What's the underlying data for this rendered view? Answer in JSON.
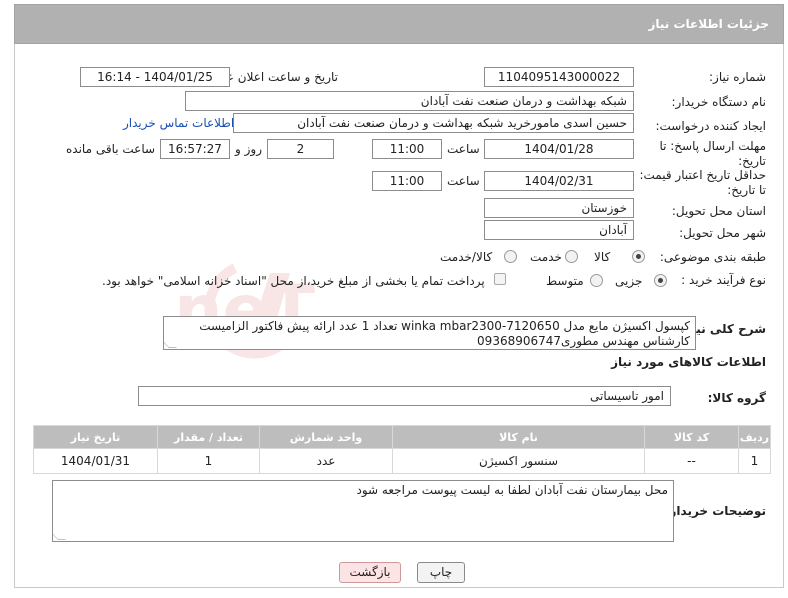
{
  "header": {
    "title": "جزئیات اطلاعات نیاز"
  },
  "fields": {
    "need_number_label": "شماره نیاز:",
    "need_number": "1104095143000022",
    "announce_label": "تاریخ و ساعت اعلان عمومی:",
    "announce_value": "1404/01/25 - 16:14",
    "buyer_org_label": "نام دستگاه خریدار:",
    "buyer_org": "شبکه بهداشت و درمان صنعت نفت آبادان",
    "requester_label": "ایجاد کننده درخواست:",
    "requester": "حسین اسدی مامورخرید شبکه بهداشت و درمان صنعت نفت آبادان",
    "contact_link": "اطلاعات تماس خریدار",
    "reply_deadline_label": "مهلت ارسال پاسخ: تا تاریخ:",
    "reply_date": "1404/01/28",
    "time_label": "ساعت",
    "reply_time": "11:00",
    "days_value": "2",
    "days_label": "روز و",
    "remaining_time": "16:57:27",
    "remaining_label": "ساعت باقی مانده",
    "price_validity_label": "حداقل تاریخ اعتبار قیمت: تا تاریخ:",
    "price_date": "1404/02/31",
    "price_time": "11:00",
    "province_label": "استان محل تحویل:",
    "province": "خوزستان",
    "city_label": "شهر محل تحویل:",
    "city": "آبادان",
    "category_label": "طبقه بندی موضوعی:",
    "category_options": [
      "کالا",
      "خدمت",
      "کالا/خدمت"
    ],
    "process_label": "نوع فرآیند خرید :",
    "process_options": [
      "جزیی",
      "متوسط"
    ],
    "payment_note": "پرداخت تمام یا بخشی از مبلغ خرید،از محل \"اسناد خزانه اسلامی\" خواهد بود.",
    "description_label": "شرح کلی نیاز:",
    "description": "کپسول اکسیژن مایع مدل winka mbar2300-7120650 تعداد 1 عدد ارائه پیش فاکتور الزامیست کارشناس مهندس مطوری09368906747",
    "goods_info_title": "اطلاعات کالاهای مورد نیاز",
    "goods_group_label": "گروه کالا:",
    "goods_group": "امور تاسیساتی",
    "buyer_notes_label": "توضیحات خریدار:",
    "buyer_notes": "محل بیمارستان نفت آبادان لطفا به لیست پیوست مراجعه شود"
  },
  "table": {
    "headers": [
      "ردیف",
      "کد کالا",
      "نام کالا",
      "واحد شمارش",
      "تعداد / مقدار",
      "تاریخ نیاز"
    ],
    "rows": [
      [
        "1",
        "--",
        "سنسور اکسیژن",
        "عدد",
        "1",
        "1404/01/31"
      ]
    ]
  },
  "buttons": {
    "print": "چاپ",
    "back": "بازگشت"
  },
  "watermark": {
    "text": "AriaTender.neT"
  }
}
